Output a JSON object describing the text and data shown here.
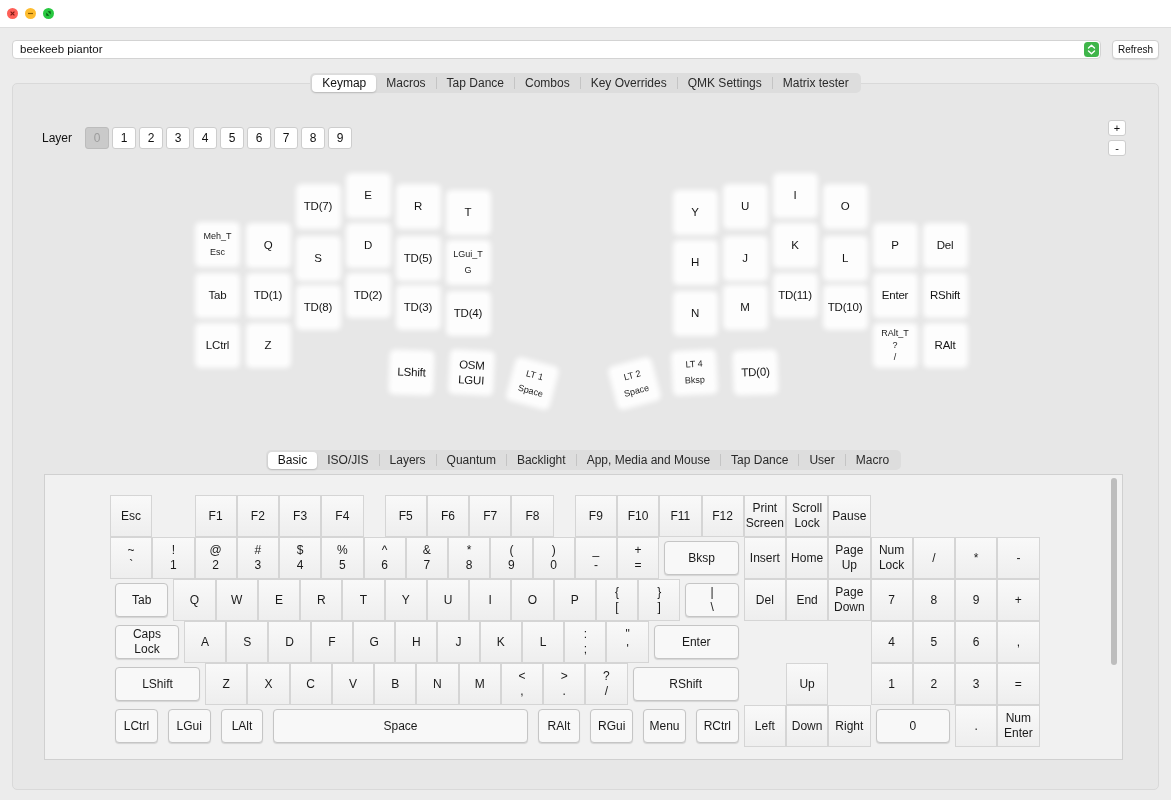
{
  "device_selector": {
    "value": "beekeeb piantor"
  },
  "refresh_button": {
    "label": "Refresh"
  },
  "tabs": [
    {
      "label": "Keymap",
      "selected": true
    },
    {
      "label": "Macros",
      "selected": false
    },
    {
      "label": "Tap Dance",
      "selected": false
    },
    {
      "label": "Combos",
      "selected": false
    },
    {
      "label": "Key Overrides",
      "selected": false
    },
    {
      "label": "QMK Settings",
      "selected": false
    },
    {
      "label": "Matrix tester",
      "selected": false
    }
  ],
  "layer_selector": {
    "label": "Layer",
    "layers": [
      {
        "label": "0",
        "selected": true
      },
      {
        "label": "1",
        "selected": false
      },
      {
        "label": "2",
        "selected": false
      },
      {
        "label": "3",
        "selected": false
      },
      {
        "label": "4",
        "selected": false
      },
      {
        "label": "5",
        "selected": false
      },
      {
        "label": "6",
        "selected": false
      },
      {
        "label": "7",
        "selected": false
      },
      {
        "label": "8",
        "selected": false
      },
      {
        "label": "9",
        "selected": false
      }
    ]
  },
  "plus_minus_buttons": [
    {
      "label": "+"
    },
    {
      "label": "-"
    }
  ],
  "keymap": {
    "left_half": [
      {
        "kind": "plain",
        "lines": [
          "TD(7)"
        ]
      },
      {
        "kind": "plain",
        "lines": [
          "E"
        ]
      },
      {
        "kind": "plain",
        "lines": [
          "R"
        ]
      },
      {
        "kind": "plain",
        "lines": [
          "T"
        ]
      },
      {
        "kind": "masked",
        "lines": [
          "Meh_T",
          "Esc"
        ]
      },
      {
        "kind": "plain",
        "lines": [
          "Q"
        ]
      },
      {
        "kind": "plain",
        "lines": [
          "S"
        ]
      },
      {
        "kind": "plain",
        "lines": [
          "D"
        ]
      },
      {
        "kind": "plain",
        "lines": [
          "TD(5)"
        ]
      },
      {
        "kind": "masked",
        "lines": [
          "LGui_T",
          "G"
        ]
      },
      {
        "kind": "plain",
        "lines": [
          "Tab"
        ]
      },
      {
        "kind": "plain",
        "lines": [
          "TD(1)"
        ]
      },
      {
        "kind": "plain",
        "lines": [
          "TD(8)"
        ]
      },
      {
        "kind": "plain",
        "lines": [
          "TD(2)"
        ]
      },
      {
        "kind": "plain",
        "lines": [
          "TD(3)"
        ]
      },
      {
        "kind": "plain",
        "lines": [
          "TD(4)"
        ]
      },
      {
        "kind": "plain",
        "lines": [
          "LCtrl"
        ]
      },
      {
        "kind": "plain",
        "lines": [
          "Z"
        ]
      },
      {
        "kind": "plain",
        "lines": [
          "LShift"
        ]
      },
      {
        "kind": "plain",
        "lines": [
          "OSM",
          "LGUI"
        ]
      },
      {
        "kind": "masked",
        "lines": [
          "LT 1",
          "Space"
        ]
      }
    ],
    "right_half": [
      {
        "kind": "plain",
        "lines": [
          "Y"
        ]
      },
      {
        "kind": "plain",
        "lines": [
          "U"
        ]
      },
      {
        "kind": "plain",
        "lines": [
          "I"
        ]
      },
      {
        "kind": "plain",
        "lines": [
          "O"
        ]
      },
      {
        "kind": "plain",
        "lines": [
          "H"
        ]
      },
      {
        "kind": "plain",
        "lines": [
          "J"
        ]
      },
      {
        "kind": "plain",
        "lines": [
          "K"
        ]
      },
      {
        "kind": "plain",
        "lines": [
          "L"
        ]
      },
      {
        "kind": "plain",
        "lines": [
          "P"
        ]
      },
      {
        "kind": "plain",
        "lines": [
          "Del"
        ]
      },
      {
        "kind": "plain",
        "lines": [
          "N"
        ]
      },
      {
        "kind": "plain",
        "lines": [
          "M"
        ]
      },
      {
        "kind": "plain",
        "lines": [
          "TD(11)"
        ]
      },
      {
        "kind": "plain",
        "lines": [
          "TD(10)"
        ]
      },
      {
        "kind": "plain",
        "lines": [
          "Enter"
        ]
      },
      {
        "kind": "plain",
        "lines": [
          "RShift"
        ]
      },
      {
        "kind": "masked",
        "lines": [
          "RAlt_T",
          "?",
          "/"
        ]
      },
      {
        "kind": "plain",
        "lines": [
          "RAlt"
        ]
      },
      {
        "kind": "masked",
        "lines": [
          "LT 2",
          "Space"
        ]
      },
      {
        "kind": "masked",
        "lines": [
          "LT 4",
          "Bksp"
        ]
      },
      {
        "kind": "plain",
        "lines": [
          "TD(0)"
        ]
      }
    ]
  },
  "keycode_tabs": [
    {
      "label": "Basic",
      "selected": true
    },
    {
      "label": "ISO/JIS",
      "selected": false
    },
    {
      "label": "Layers",
      "selected": false
    },
    {
      "label": "Quantum",
      "selected": false
    },
    {
      "label": "Backlight",
      "selected": false
    },
    {
      "label": "App, Media and Mouse",
      "selected": false
    },
    {
      "label": "Tap Dance",
      "selected": false
    },
    {
      "label": "User",
      "selected": false
    },
    {
      "label": "Macro",
      "selected": false
    }
  ],
  "keycode_keys": [
    [
      "Esc"
    ],
    [
      "F1"
    ],
    [
      "F2"
    ],
    [
      "F3"
    ],
    [
      "F4"
    ],
    [
      "F5"
    ],
    [
      "F6"
    ],
    [
      "F7"
    ],
    [
      "F8"
    ],
    [
      "F9"
    ],
    [
      "F10"
    ],
    [
      "F11"
    ],
    [
      "F12"
    ],
    [
      "Print",
      "Screen"
    ],
    [
      "Scroll",
      "Lock"
    ],
    [
      "Pause"
    ],
    [
      "~",
      "`"
    ],
    [
      "!",
      "1"
    ],
    [
      "@",
      "2"
    ],
    [
      "#",
      "3"
    ],
    [
      "$",
      "4"
    ],
    [
      "%",
      "5"
    ],
    [
      "^",
      "6"
    ],
    [
      "&",
      "7"
    ],
    [
      "*",
      "8"
    ],
    [
      "(",
      "9"
    ],
    [
      ")",
      "0"
    ],
    [
      "_",
      "-"
    ],
    [
      "+",
      "="
    ],
    [
      "Bksp"
    ],
    [
      "Insert"
    ],
    [
      "Home"
    ],
    [
      "Page",
      "Up"
    ],
    [
      "Num",
      "Lock"
    ],
    [
      "/"
    ],
    [
      "*"
    ],
    [
      "-"
    ],
    [
      "Tab"
    ],
    [
      "Q"
    ],
    [
      "W"
    ],
    [
      "E"
    ],
    [
      "R"
    ],
    [
      "T"
    ],
    [
      "Y"
    ],
    [
      "U"
    ],
    [
      "I"
    ],
    [
      "O"
    ],
    [
      "P"
    ],
    [
      "{",
      "["
    ],
    [
      "}",
      "]"
    ],
    [
      "|",
      "\\"
    ],
    [
      "Del"
    ],
    [
      "End"
    ],
    [
      "Page",
      "Down"
    ],
    [
      "7"
    ],
    [
      "8"
    ],
    [
      "9"
    ],
    [
      "+"
    ],
    [
      "Caps",
      "Lock"
    ],
    [
      "A"
    ],
    [
      "S"
    ],
    [
      "D"
    ],
    [
      "F"
    ],
    [
      "G"
    ],
    [
      "H"
    ],
    [
      "J"
    ],
    [
      "K"
    ],
    [
      "L"
    ],
    [
      ":",
      ";"
    ],
    [
      "\"",
      "'"
    ],
    [
      "Enter"
    ],
    [
      "4"
    ],
    [
      "5"
    ],
    [
      "6"
    ],
    [
      ","
    ],
    [
      "LShift"
    ],
    [
      "Z"
    ],
    [
      "X"
    ],
    [
      "C"
    ],
    [
      "V"
    ],
    [
      "B"
    ],
    [
      "N"
    ],
    [
      "M"
    ],
    [
      "<",
      ","
    ],
    [
      ">",
      "."
    ],
    [
      "?",
      "/"
    ],
    [
      "RShift"
    ],
    [
      "Up"
    ],
    [
      "1"
    ],
    [
      "2"
    ],
    [
      "3"
    ],
    [
      "="
    ],
    [
      "LCtrl"
    ],
    [
      "LGui"
    ],
    [
      "LAlt"
    ],
    [
      "Space"
    ],
    [
      "RAlt"
    ],
    [
      "RGui"
    ],
    [
      "Menu"
    ],
    [
      "RCtrl"
    ],
    [
      "Left"
    ],
    [
      "Down"
    ],
    [
      "Right"
    ],
    [
      "0"
    ],
    [
      "."
    ],
    [
      "Num",
      "Enter"
    ]
  ]
}
